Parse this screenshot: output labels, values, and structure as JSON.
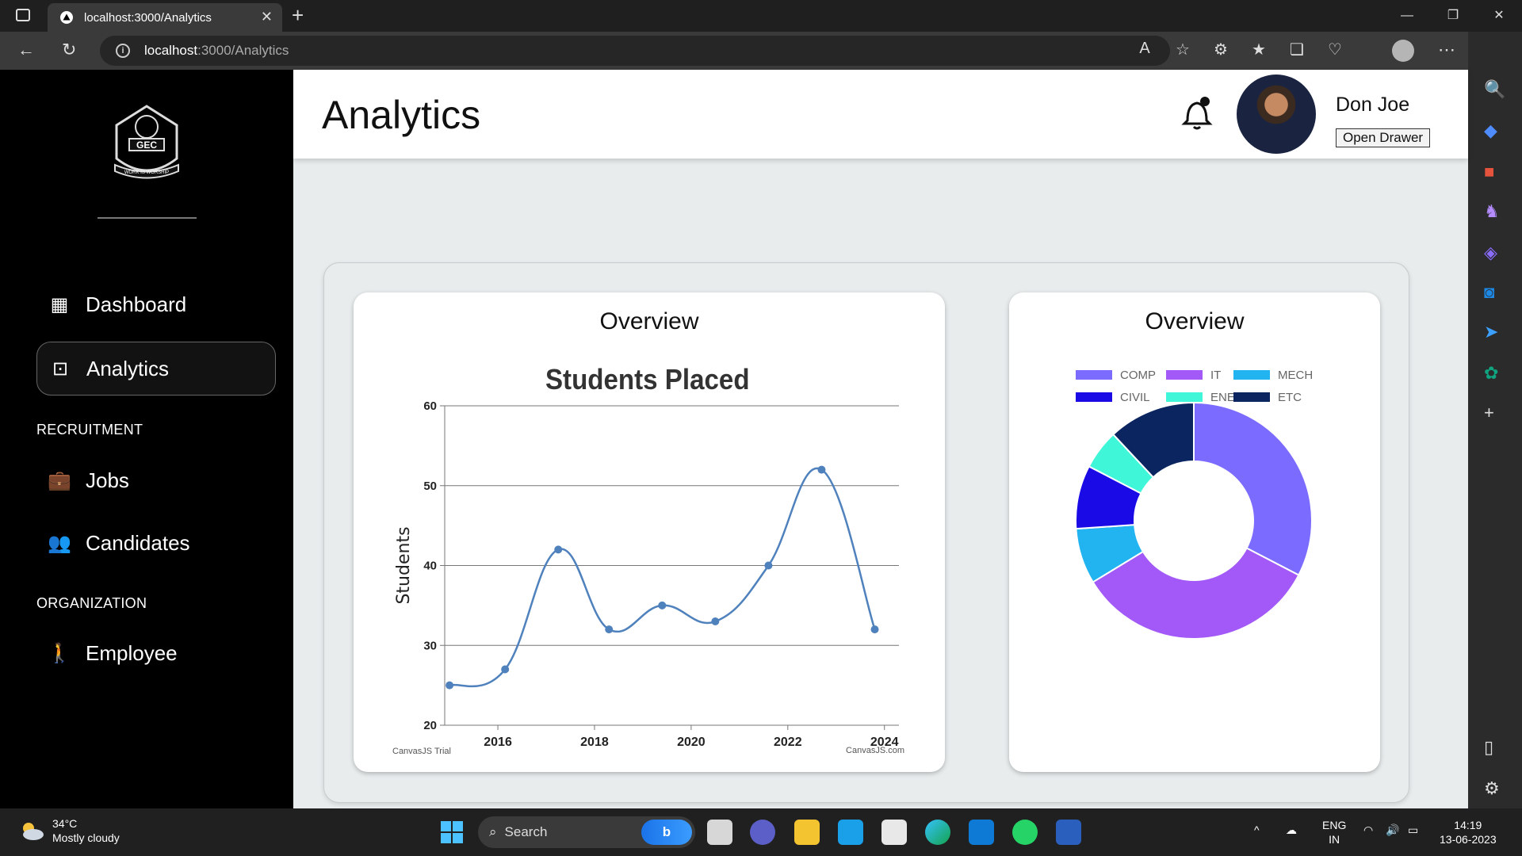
{
  "browser": {
    "tab_title": "localhost:3000/Analytics",
    "url_host": "localhost",
    "url_path": ":3000/Analytics"
  },
  "sidebar": {
    "items": [
      {
        "label": "Dashboard",
        "icon": "dashboard-icon"
      },
      {
        "label": "Analytics",
        "icon": "analytics-icon",
        "active": true
      },
      {
        "label": "Jobs",
        "icon": "briefcase-icon"
      },
      {
        "label": "Candidates",
        "icon": "people-icon"
      },
      {
        "label": "Employee",
        "icon": "employee-icon"
      }
    ],
    "sections": [
      "RECRUITMENT",
      "ORGANIZATION"
    ],
    "logo_text": [
      "GEC",
      "WORK IS WORSHIP"
    ]
  },
  "header": {
    "title": "Analytics",
    "user_name": "Don Joe",
    "drawer_button": "Open Drawer"
  },
  "line_card": {
    "title": "Overview",
    "credit_left": "CanvasJS Trial",
    "credit_right": "CanvasJS.com"
  },
  "pie_card": {
    "title": "Overview"
  },
  "chart_data": [
    {
      "type": "line",
      "title": "Students Placed",
      "ylabel": "Students",
      "xlabel": "",
      "ylim": [
        20,
        60
      ],
      "yticks": [
        20,
        30,
        40,
        50,
        60
      ],
      "xticks": [
        2016,
        2018,
        2020,
        2022,
        2024
      ],
      "xlim": [
        2014.9,
        2024.3
      ],
      "grid": true,
      "line_color": "#4f81bd",
      "points": [
        {
          "x": 2015.0,
          "y": 25
        },
        {
          "x": 2016.15,
          "y": 27
        },
        {
          "x": 2017.25,
          "y": 42
        },
        {
          "x": 2018.3,
          "y": 32
        },
        {
          "x": 2019.4,
          "y": 35
        },
        {
          "x": 2020.5,
          "y": 33
        },
        {
          "x": 2021.6,
          "y": 40
        },
        {
          "x": 2022.7,
          "y": 52
        },
        {
          "x": 2023.8,
          "y": 32
        }
      ]
    },
    {
      "type": "pie",
      "variant": "doughnut",
      "legend_position": "top",
      "slices": [
        {
          "label": "COMP",
          "value": 30,
          "color": "#7b6cff"
        },
        {
          "label": "IT",
          "value": 31,
          "color": "#a259f7"
        },
        {
          "label": "MECH",
          "value": 7,
          "color": "#22b4f0"
        },
        {
          "label": "CIVIL",
          "value": 8,
          "color": "#1a0ae6"
        },
        {
          "label": "ENE",
          "value": 5,
          "color": "#3ff7d8"
        },
        {
          "label": "ETC",
          "value": 11,
          "color": "#0b2560"
        }
      ]
    }
  ],
  "taskbar": {
    "temperature": "34°C",
    "weather": "Mostly cloudy",
    "search": "Search",
    "lang_1": "ENG",
    "lang_2": "IN",
    "time": "14:19",
    "date": "13-06-2023"
  }
}
